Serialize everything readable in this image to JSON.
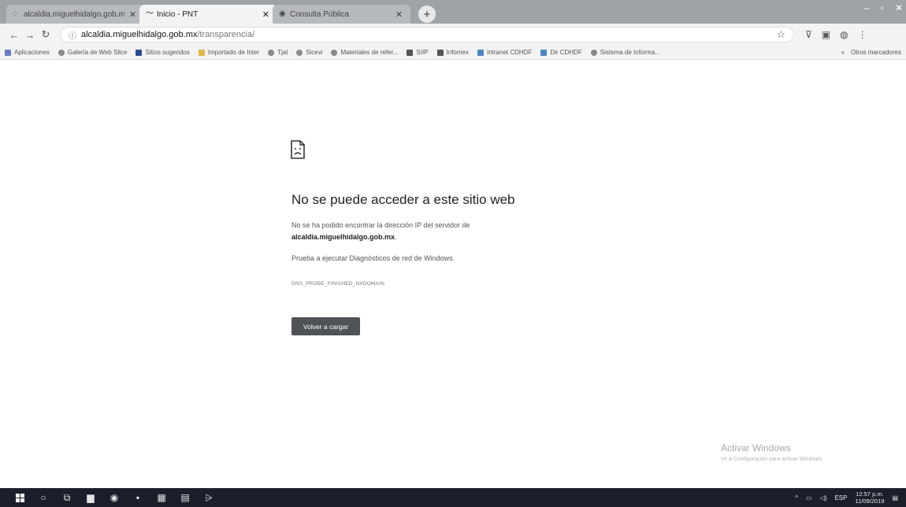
{
  "browser": {
    "tabs": [
      {
        "title": "alcaldia.miguelhidalgo.gob.mx",
        "icon": "page-icon",
        "active": false
      },
      {
        "title": "Inicio - PNT",
        "icon": "pnt-logo-icon",
        "active": true
      },
      {
        "title": "Consulta Pública",
        "icon": "globe-icon",
        "active": false
      }
    ],
    "new_tab": "+",
    "address": {
      "host": "alcaldia.miguelhidalgo.gob.mx",
      "path": "/transparencia/"
    },
    "bookmarks": [
      {
        "label": "Aplicaciones",
        "color": "#6b7cc4"
      },
      {
        "label": "Galería de Web Slice",
        "color": "#8a8a8a"
      },
      {
        "label": "Sitios sugeridos",
        "color": "#2b4f8f"
      },
      {
        "label": "Importado de Inter",
        "color": "#e0b84a"
      },
      {
        "label": "Tjal",
        "color": "#8a8a8a"
      },
      {
        "label": "Sicevi",
        "color": "#8a8a8a"
      },
      {
        "label": "Materiales de refer...",
        "color": "#8a8a8a"
      },
      {
        "label": "SIIP",
        "color": "#555555"
      },
      {
        "label": "Infomex",
        "color": "#555555"
      },
      {
        "label": "Intranet CDHDF",
        "color": "#4a88c4"
      },
      {
        "label": "Dir CDHDF",
        "color": "#4a88c4"
      },
      {
        "label": "Sistema de Informa...",
        "color": "#8a8a8a"
      }
    ],
    "other_bookmarks": "Otros marcadores"
  },
  "error_page": {
    "title": "No se puede acceder a este sitio web",
    "line1": "No se ha podido encontrar la dirección IP del servidor de",
    "host": "alcaldia.miguelhidalgo.gob.mx",
    "host_suffix": ".",
    "suggestion": "Prueba a ejecutar Diagnósticos de red de Windows.",
    "code": "DNS_PROBE_FINISHED_NXDOMAIN",
    "reload_label": "Volver a cargar"
  },
  "watermark": {
    "title": "Activar Windows",
    "subtitle": "Ve a Configuración para activar Windows."
  },
  "taskbar": {
    "language": "ESP",
    "time": "12:57 p.m.",
    "date": "11/09/2019"
  }
}
